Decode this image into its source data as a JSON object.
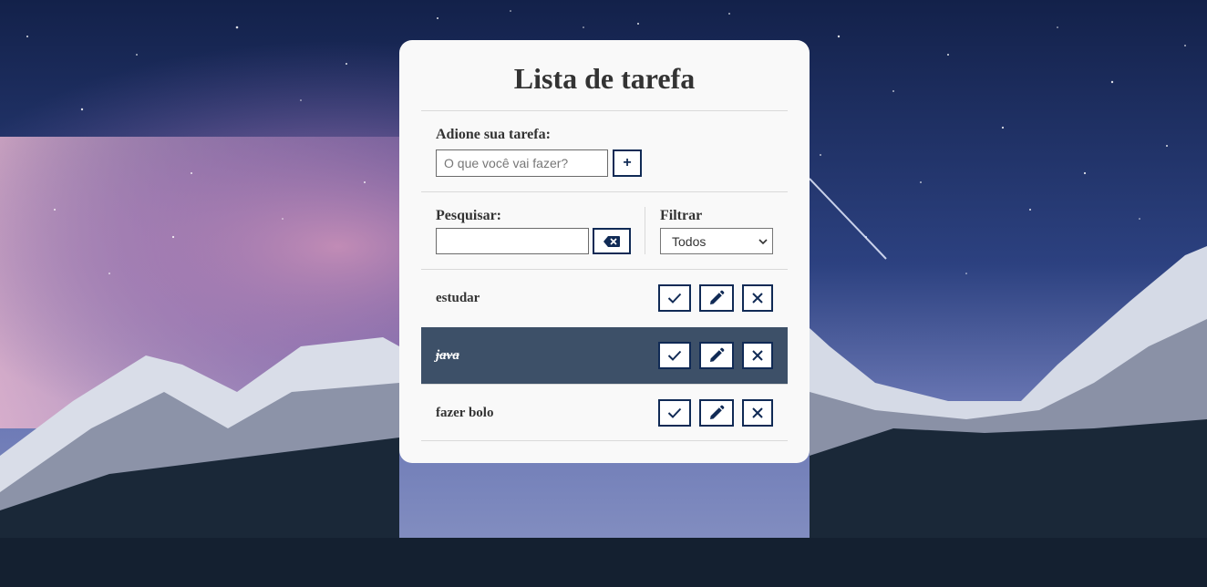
{
  "app": {
    "title": "Lista de tarefa"
  },
  "add_section": {
    "label": "Adione sua tarefa:",
    "placeholder": "O que você vai fazer?",
    "add_button_label": "+"
  },
  "search_section": {
    "label": "Pesquisar:",
    "value": "",
    "clear_icon": "backspace-icon"
  },
  "filter_section": {
    "label": "Filtrar",
    "selected": "Todos"
  },
  "tasks": [
    {
      "text": "estudar",
      "done": false
    },
    {
      "text": "java",
      "done": true
    },
    {
      "text": "fazer bolo",
      "done": false
    }
  ],
  "task_actions": [
    "check-icon",
    "pencil-icon",
    "close-icon"
  ],
  "colors": {
    "accent": "#102a55",
    "done_row": "#3d5068",
    "card": "#f9f9f9"
  }
}
